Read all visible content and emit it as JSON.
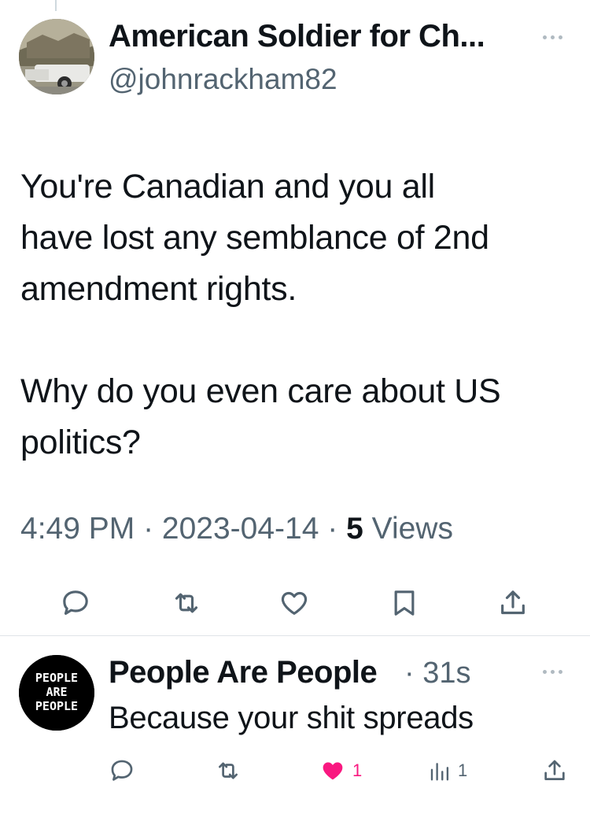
{
  "tweet": {
    "author_name": "American Soldier for Ch...",
    "handle": "@johnrackham82",
    "text": "You're Canadian and you all\nhave lost any semblance of 2nd\namendment rights.\n\nWhy do you even care about US\npolitics?",
    "time": "4:49 PM",
    "date": "2023-04-14",
    "views_count": "5",
    "views_label": "Views",
    "separator": " · "
  },
  "reply": {
    "author_name": "People Are People",
    "time": "· 31s",
    "text": "Because your shit spreads",
    "avatar_text": [
      "PEOPLE",
      "ARE",
      "PEOPLE"
    ],
    "likes": "1",
    "views": "1"
  },
  "icons": {
    "reply": "speech-bubble-icon",
    "retweet": "retweet-icon",
    "like": "heart-icon",
    "bookmark": "bookmark-icon",
    "share": "share-icon",
    "views": "bar-chart-icon",
    "more": "more-dots-icon"
  },
  "colors": {
    "text": "#0f1419",
    "secondary": "#536471",
    "like_active": "#f91880",
    "divider": "#dfe4e8"
  }
}
